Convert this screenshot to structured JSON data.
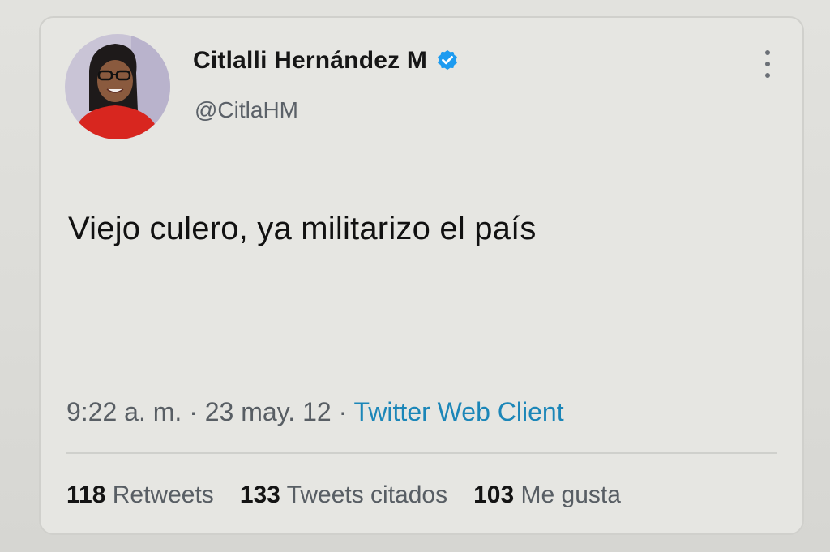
{
  "tweet": {
    "display_name": "Citlalli Hernández M",
    "handle": "@CitlaHM",
    "verified": true,
    "text": "Viejo culero, ya militarizo el país",
    "time": "9:22 a. m.",
    "separator": "·",
    "date": "23 may. 12",
    "source": "Twitter Web Client",
    "stats": [
      {
        "count": "118",
        "label": "Retweets"
      },
      {
        "count": "133",
        "label": "Tweets citados"
      },
      {
        "count": "103",
        "label": "Me gusta"
      }
    ]
  },
  "colors": {
    "verified_badge": "#1d9bf0",
    "source_link": "#1b86b8",
    "avatar_shirt": "#d8261f"
  },
  "icons": {
    "verified": "verified-badge-icon",
    "more": "more-options-icon",
    "avatar": "profile-photo"
  }
}
